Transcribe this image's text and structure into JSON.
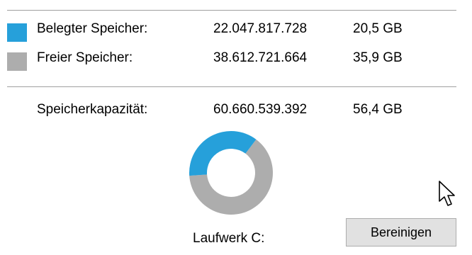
{
  "colors": {
    "used": "#26a0da",
    "free": "#adadad"
  },
  "usage": {
    "used": {
      "label": "Belegter Speicher:",
      "bytes": "22.047.817.728",
      "size": "20,5 GB"
    },
    "free": {
      "label": "Freier Speicher:",
      "bytes": "38.612.721.664",
      "size": "35,9 GB"
    },
    "capacity": {
      "label": "Speicherkapazität:",
      "bytes": "60.660.539.392",
      "size": "56,4 GB"
    }
  },
  "drive": {
    "label": "Laufwerk C:",
    "used_fraction": 0.3635
  },
  "cleanup_button": {
    "label": "Bereinigen"
  },
  "cursor_icon": "arrow-cursor-icon"
}
